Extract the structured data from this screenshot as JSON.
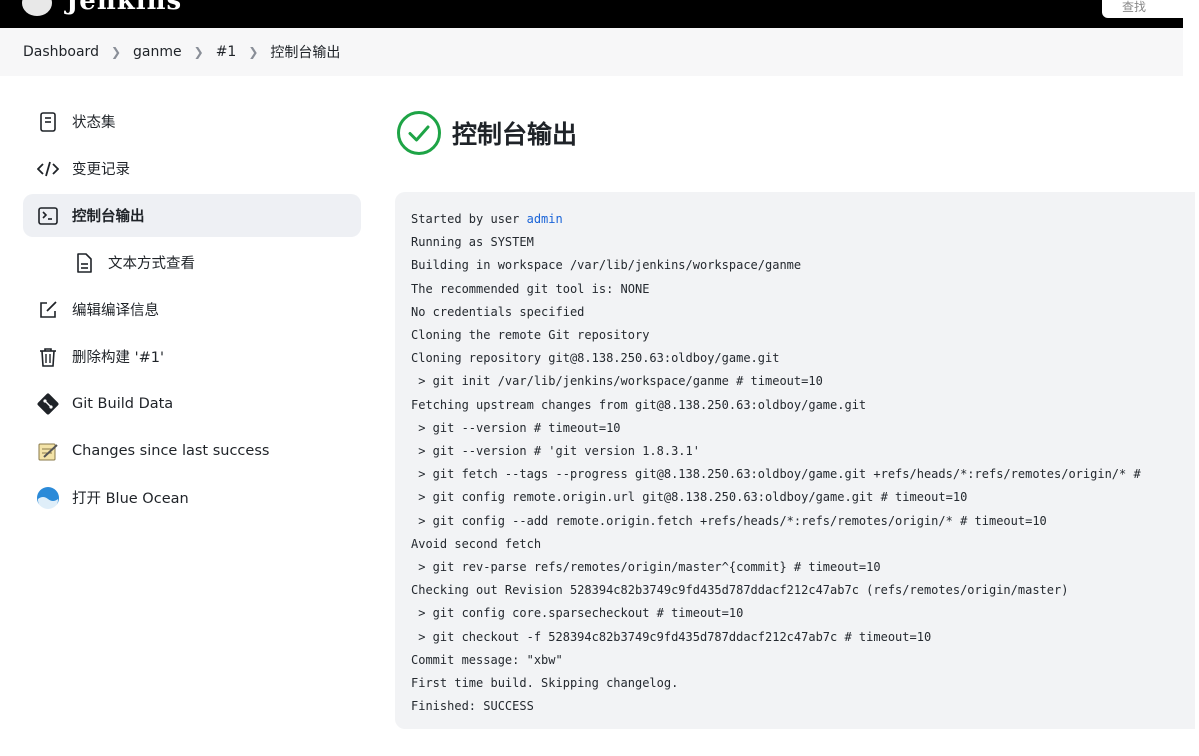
{
  "header": {
    "logo_text": "Jenkins",
    "search_placeholder": "查找"
  },
  "breadcrumb": [
    "Dashboard",
    "ganme",
    "#1",
    "控制台输出"
  ],
  "sidebar": {
    "items": [
      {
        "label": "状态集",
        "icon": "document-icon"
      },
      {
        "label": "变更记录",
        "icon": "code-icon"
      },
      {
        "label": "控制台输出",
        "icon": "terminal-icon",
        "active": true
      },
      {
        "label": "文本方式查看",
        "icon": "file-icon",
        "sub": true
      },
      {
        "label": "编辑编译信息",
        "icon": "edit-icon"
      },
      {
        "label": "删除构建 '#1'",
        "icon": "trash-icon"
      },
      {
        "label": "Git Build Data",
        "icon": "git-icon"
      },
      {
        "label": "Changes since last success",
        "icon": "notepad-icon"
      },
      {
        "label": "打开 Blue Ocean",
        "icon": "blue-ocean-icon"
      }
    ]
  },
  "main": {
    "title": "控制台输出",
    "status_color": "#1ea446",
    "console": {
      "user_prefix": "Started by user ",
      "user": "admin",
      "lines": [
        "Running as SYSTEM",
        "Building in workspace /var/lib/jenkins/workspace/ganme",
        "The recommended git tool is: NONE",
        "No credentials specified",
        "Cloning the remote Git repository",
        "Cloning repository git@8.138.250.63:oldboy/game.git",
        " > git init /var/lib/jenkins/workspace/ganme # timeout=10",
        "Fetching upstream changes from git@8.138.250.63:oldboy/game.git",
        " > git --version # timeout=10",
        " > git --version # 'git version 1.8.3.1'",
        " > git fetch --tags --progress git@8.138.250.63:oldboy/game.git +refs/heads/*:refs/remotes/origin/* #",
        " > git config remote.origin.url git@8.138.250.63:oldboy/game.git # timeout=10",
        " > git config --add remote.origin.fetch +refs/heads/*:refs/remotes/origin/* # timeout=10",
        "Avoid second fetch",
        " > git rev-parse refs/remotes/origin/master^{commit} # timeout=10",
        "Checking out Revision 528394c82b3749c9fd435d787ddacf212c47ab7c (refs/remotes/origin/master)",
        " > git config core.sparsecheckout # timeout=10",
        " > git checkout -f 528394c82b3749c9fd435d787ddacf212c47ab7c # timeout=10",
        "Commit message: \"xbw\"",
        "First time build. Skipping changelog.",
        "Finished: SUCCESS"
      ]
    }
  }
}
